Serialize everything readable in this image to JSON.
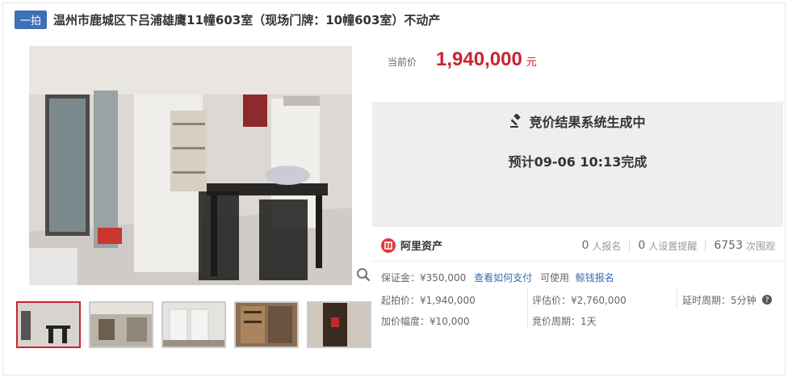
{
  "header": {
    "badge": "一拍",
    "title": "温州市鹿城区下吕浦雄鹰11幢603室（现场门牌：10幢603室）不动产"
  },
  "price": {
    "label": "当前价",
    "value": "1,940,000",
    "unit": "元"
  },
  "status": {
    "title": "竞价结果系统生成中",
    "subtitle": "预计09-06 10:13完成"
  },
  "platform": {
    "name": "阿里资产"
  },
  "stats": [
    {
      "num": "0",
      "label": "人报名"
    },
    {
      "num": "0",
      "label": "人设置提醒"
    },
    {
      "num": "6753",
      "label": "次围观"
    }
  ],
  "deposit": {
    "label": "保证金：¥350,000",
    "how_to_pay": "查看如何支付",
    "usable": "可使用",
    "loan": "鲸钱报名"
  },
  "details": {
    "start_price": "起拍价：¥1,940,000",
    "assessed": "评估价：¥2,760,000",
    "delay": "延时周期：5分钟",
    "increment": "加价幅度：¥10,000",
    "period": "竞价周期：1天"
  },
  "icons": {
    "gavel": "gavel-icon",
    "zoom": "zoom-icon",
    "help": "help-icon",
    "logo": "ali-asset-logo-icon"
  },
  "colors": {
    "accent_red": "#c9252d",
    "badge_blue": "#3f6fb4",
    "link_blue": "#3a6cb2"
  }
}
